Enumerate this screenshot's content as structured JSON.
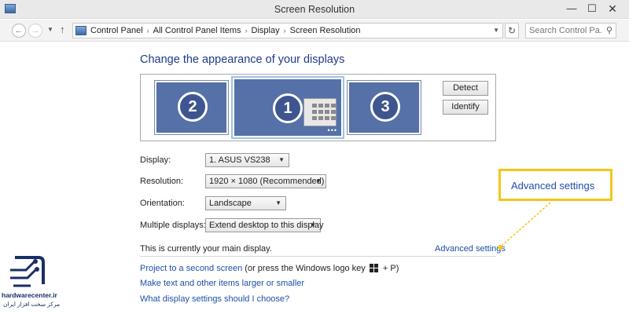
{
  "window": {
    "title": "Screen Resolution",
    "controls": {
      "minimize": "—",
      "maximize": "☐",
      "close": "✕"
    }
  },
  "address_bar": {
    "breadcrumbs": [
      "Control Panel",
      "All Control Panel Items",
      "Display",
      "Screen Resolution"
    ],
    "search_placeholder": "Search Control Pa..."
  },
  "content": {
    "heading": "Change the appearance of your displays",
    "monitors": [
      "2",
      "1",
      "3"
    ],
    "detect_button": "Detect",
    "identify_button": "Identify",
    "fields": {
      "display": {
        "label": "Display:",
        "value": "1. ASUS VS238"
      },
      "resolution": {
        "label": "Resolution:",
        "value": "1920 × 1080 (Recommended)"
      },
      "orientation": {
        "label": "Orientation:",
        "value": "Landscape"
      },
      "multiple_displays": {
        "label": "Multiple displays:",
        "value": "Extend desktop to this display"
      }
    },
    "main_display_text": "This is currently your main display.",
    "advanced_settings_link": "Advanced settings",
    "links": {
      "project": "Project to a second screen",
      "project_suffix_a": " (or press the Windows logo key ",
      "project_suffix_b": " + P)",
      "text_size": "Make text and other items larger or smaller",
      "which_settings": "What display settings should I choose?"
    }
  },
  "callout": {
    "text": "Advanced settings",
    "color": "#f5c518"
  },
  "watermark": {
    "brand": "hardwarecenter.ir",
    "subtitle": "مرکز سخت افزار ایران"
  }
}
